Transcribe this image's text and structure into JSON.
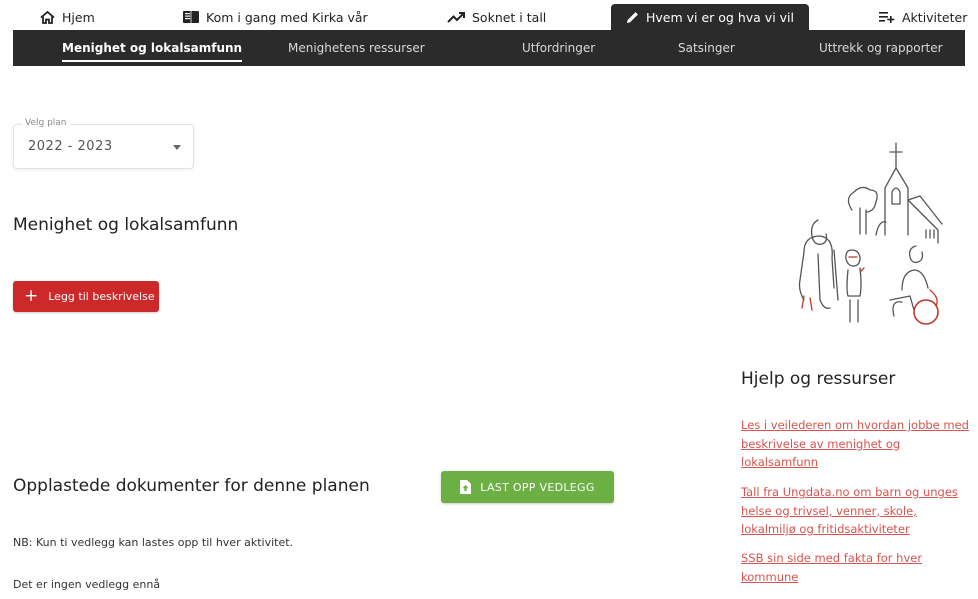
{
  "top_nav": {
    "tabs": [
      {
        "label": "Hjem",
        "icon": "home-icon"
      },
      {
        "label": "Kom i gang med Kirka vår",
        "icon": "book-icon"
      },
      {
        "label": "Soknet i tall",
        "icon": "trending-up-icon"
      },
      {
        "label": "Hvem vi er og hva vi vil",
        "icon": "pencil-icon",
        "active": true
      },
      {
        "label": "Aktiviteter",
        "icon": "playlist-add-icon"
      }
    ]
  },
  "sub_nav": {
    "items": [
      {
        "label": "Menighet og lokalsamfunn",
        "active": true
      },
      {
        "label": "Menighetens ressurser"
      },
      {
        "label": "Utfordringer"
      },
      {
        "label": "Satsinger"
      },
      {
        "label": "Uttrekk og rapporter"
      }
    ]
  },
  "plan_select": {
    "label": "Velg plan",
    "value": "2022 - 2023"
  },
  "main": {
    "section_title": "Menighet og lokalsamfunn",
    "add_button": "Legg til beskrivelse",
    "docs_title": "Opplastede dokumenter for denne planen",
    "upload_button": "LAST OPP VEDLEGG",
    "nb_text": "NB: Kun ti vedlegg kan lastes opp til hver aktivitet.",
    "empty_text": "Det er ingen vedlegg ennå"
  },
  "help": {
    "title": "Hjelp og ressurser",
    "links": [
      "Les i veilederen om hvordan jobbe med beskrivelse av menighet og lokalsamfunn",
      "Tall fra Ungdata.no om barn og unges helse og trivsel, venner, skole, lokalmiljø og fritidsaktiviteter",
      "SSB sin side med fakta for hver kommune"
    ]
  },
  "colors": {
    "nav_dark": "#2b2b2b",
    "add_button": "#cc2a2a",
    "upload_button": "#6cb043",
    "link": "#d9534f"
  }
}
